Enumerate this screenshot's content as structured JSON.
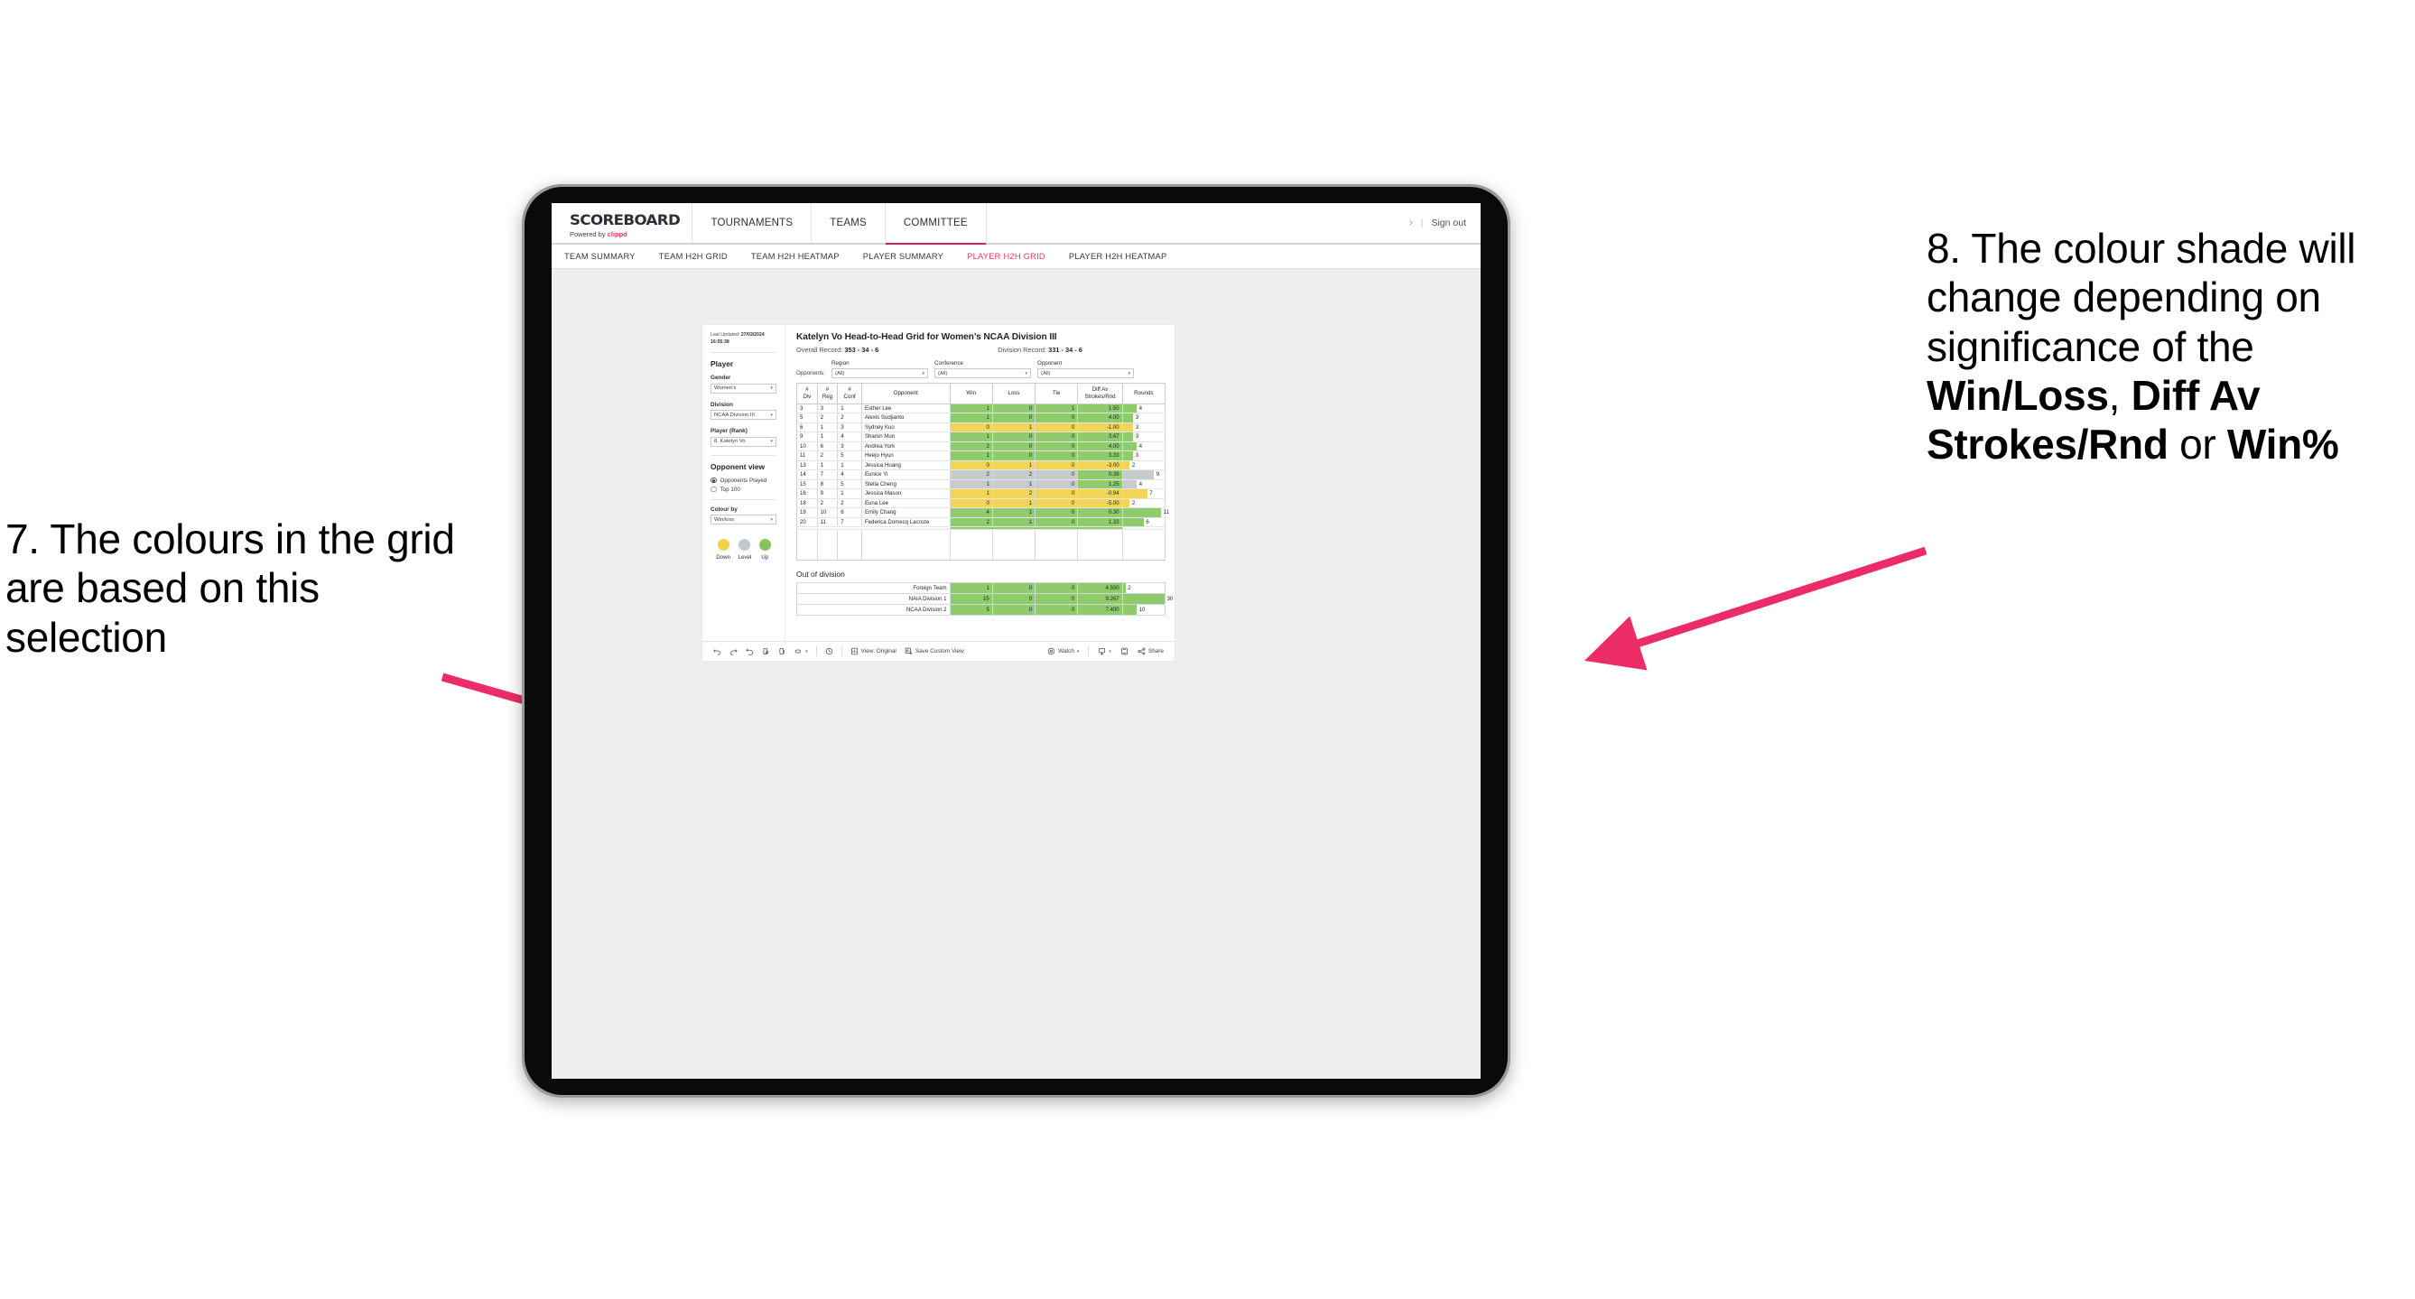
{
  "annotations": {
    "left": "7. The colours in the grid are based on this selection",
    "right_pre": "8. The colour shade will change depending on significance of the ",
    "right_b1": "Win/Loss",
    "right_mid1": ", ",
    "right_b2": "Diff Av Strokes/Rnd",
    "right_mid2": " or ",
    "right_b3": "Win%",
    "arrow_color": "#ec2c67"
  },
  "header": {
    "brand_name": "SCOREBOARD",
    "brand_sub_prefix": "Powered by ",
    "brand_sub_clippd": "clippd",
    "nav": [
      {
        "label": "TOURNAMENTS",
        "active": false
      },
      {
        "label": "TEAMS",
        "active": false
      },
      {
        "label": "COMMITTEE",
        "active": true
      }
    ],
    "chevron": "›",
    "divider": "|",
    "sign_out": "Sign out"
  },
  "subnav": [
    {
      "label": "TEAM SUMMARY",
      "active": false
    },
    {
      "label": "TEAM H2H GRID",
      "active": false
    },
    {
      "label": "TEAM H2H HEATMAP",
      "active": false
    },
    {
      "label": "PLAYER SUMMARY",
      "active": false
    },
    {
      "label": "PLAYER H2H GRID",
      "active": true
    },
    {
      "label": "PLAYER H2H HEATMAP",
      "active": false
    }
  ],
  "sidebar": {
    "last_updated_label": "Last Updated: ",
    "last_updated_value": "27/03/2024 16:55:38",
    "player_heading": "Player",
    "gender_label": "Gender",
    "gender_value": "Women’s",
    "division_label": "Division",
    "division_value": "NCAA Division III",
    "player_rank_label": "Player (Rank)",
    "player_rank_value": "8. Katelyn Vo",
    "opponent_view_heading": "Opponent view",
    "opponent_view_options": [
      {
        "label": "Opponents Played",
        "selected": true
      },
      {
        "label": "Top 100",
        "selected": false
      }
    ],
    "colour_by_label": "Colour by",
    "colour_by_value": "Win/loss",
    "legend": [
      {
        "label": "Down",
        "color": "#f2d14b"
      },
      {
        "label": "Level",
        "color": "#c5c8cc"
      },
      {
        "label": "Up",
        "color": "#82c45f"
      }
    ],
    "caret": "▾"
  },
  "main": {
    "title": "Katelyn Vo Head-to-Head Grid for Women’s NCAA Division III",
    "overall_record_label": "Overall Record: ",
    "overall_record_value": "353 -  34 - 6",
    "division_record_label": "Division Record: ",
    "division_record_value": "331 -  34 - 6",
    "opponents_label": "Opponents:",
    "filters": [
      {
        "label": "Region",
        "value": "(All)"
      },
      {
        "label": "Conference",
        "value": "(All)"
      },
      {
        "label": "Opponent",
        "value": "(All)"
      }
    ],
    "columns": [
      "# Div",
      "# Reg",
      "# Conf",
      "Opponent",
      "Win",
      "Loss",
      "Tie",
      "Diff Av Strokes/Rnd",
      "Rounds"
    ],
    "rows": [
      {
        "div": "3",
        "reg": "3",
        "conf": "1",
        "opponent": "Esther Lee",
        "win": "1",
        "loss": "0",
        "tie": "1",
        "diff": "1.50",
        "rounds": "4",
        "status": "up"
      },
      {
        "div": "5",
        "reg": "2",
        "conf": "2",
        "opponent": "Alexis Sudjianto",
        "win": "1",
        "loss": "0",
        "tie": "0",
        "diff": "4.00",
        "rounds": "3",
        "status": "up"
      },
      {
        "div": "6",
        "reg": "1",
        "conf": "3",
        "opponent": "Sydney Kuo",
        "win": "0",
        "loss": "1",
        "tie": "0",
        "diff": "-1.00",
        "rounds": "3",
        "status": "down"
      },
      {
        "div": "9",
        "reg": "1",
        "conf": "4",
        "opponent": "Sharon Mun",
        "win": "1",
        "loss": "0",
        "tie": "0",
        "diff": "3.67",
        "rounds": "3",
        "status": "up"
      },
      {
        "div": "10",
        "reg": "6",
        "conf": "3",
        "opponent": "Andrea York",
        "win": "2",
        "loss": "0",
        "tie": "0",
        "diff": "4.00",
        "rounds": "4",
        "status": "up"
      },
      {
        "div": "11",
        "reg": "2",
        "conf": "5",
        "opponent": "Heejo Hyun",
        "win": "1",
        "loss": "0",
        "tie": "0",
        "diff": "3.33",
        "rounds": "3",
        "status": "up"
      },
      {
        "div": "13",
        "reg": "1",
        "conf": "1",
        "opponent": "Jessica Huang",
        "win": "0",
        "loss": "1",
        "tie": "0",
        "diff": "-3.00",
        "rounds": "2",
        "status": "down"
      },
      {
        "div": "14",
        "reg": "7",
        "conf": "4",
        "opponent": "Eunice Yi",
        "win": "2",
        "loss": "2",
        "tie": "0",
        "diff": "0.38",
        "rounds": "9",
        "status": "level",
        "diff_status": "up"
      },
      {
        "div": "15",
        "reg": "8",
        "conf": "5",
        "opponent": "Stella Cheng",
        "win": "1",
        "loss": "1",
        "tie": "0",
        "diff": "1.25",
        "rounds": "4",
        "status": "level",
        "diff_status": "up"
      },
      {
        "div": "16",
        "reg": "9",
        "conf": "1",
        "opponent": "Jessica Mason",
        "win": "1",
        "loss": "2",
        "tie": "0",
        "diff": "-0.94",
        "rounds": "7",
        "status": "down"
      },
      {
        "div": "18",
        "reg": "2",
        "conf": "2",
        "opponent": "Euna Lee",
        "win": "0",
        "loss": "1",
        "tie": "0",
        "diff": "-5.00",
        "rounds": "2",
        "status": "down"
      },
      {
        "div": "19",
        "reg": "10",
        "conf": "6",
        "opponent": "Emily Chang",
        "win": "4",
        "loss": "1",
        "tie": "0",
        "diff": "0.30",
        "rounds": "11",
        "status": "up"
      },
      {
        "div": "20",
        "reg": "11",
        "conf": "7",
        "opponent": "Federica Domecq Lacroze",
        "win": "2",
        "loss": "1",
        "tie": "0",
        "diff": "1.33",
        "rounds": "6",
        "status": "up"
      }
    ],
    "out_of_division_title": "Out of division",
    "out_of_division_rows": [
      {
        "name": "Foreign Team",
        "win": "1",
        "loss": "0",
        "tie": "0",
        "diff": "4.500",
        "rounds": "2",
        "status": "up"
      },
      {
        "name": "NAIA Division 1",
        "win": "15",
        "loss": "0",
        "tie": "0",
        "diff": "9.267",
        "rounds": "30",
        "status": "up"
      },
      {
        "name": "NCAA Division 2",
        "win": "5",
        "loss": "0",
        "tie": "0",
        "diff": "7.400",
        "rounds": "10",
        "status": "up"
      }
    ],
    "max_rounds": 30
  },
  "toolbar": {
    "undo_icon": "undo-icon",
    "redo_icon": "redo-icon",
    "revert_icon": "revert-icon",
    "refresh_icon": "refresh-icon",
    "pause_icon": "pause-icon",
    "alerts_icon": "alerts-icon",
    "view_label": "View: Original",
    "save_label": "Save Custom View",
    "watch_label": "Watch",
    "share_label": "Share",
    "caret": "▾"
  },
  "colors": {
    "up": "#8ecc6b",
    "down": "#f2d557",
    "level": "#c8cbce",
    "accent": "#d81e5b"
  }
}
